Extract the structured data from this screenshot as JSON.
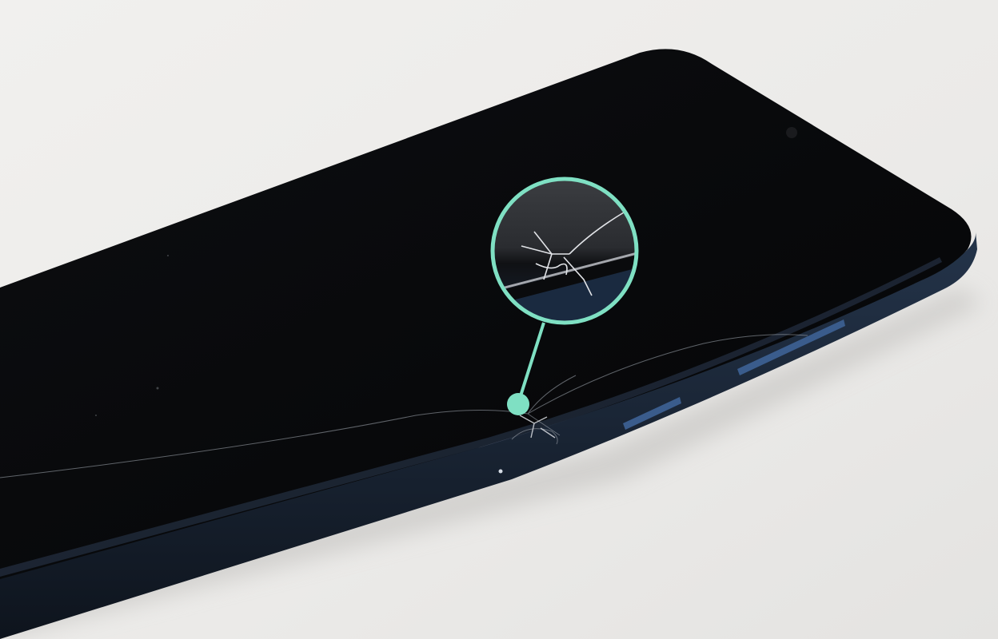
{
  "scene": {
    "subject": "smartphone-with-cracked-screen-edge",
    "background_color": "#ecebe9",
    "phone_body_color": "#0b0c0f",
    "phone_frame_color": "#1b2636",
    "button_color": "#3a5c8c",
    "highlight_color": "#7fe0c3",
    "icons": [
      "magnifier-callout-icon",
      "pointer-dot-icon"
    ]
  }
}
